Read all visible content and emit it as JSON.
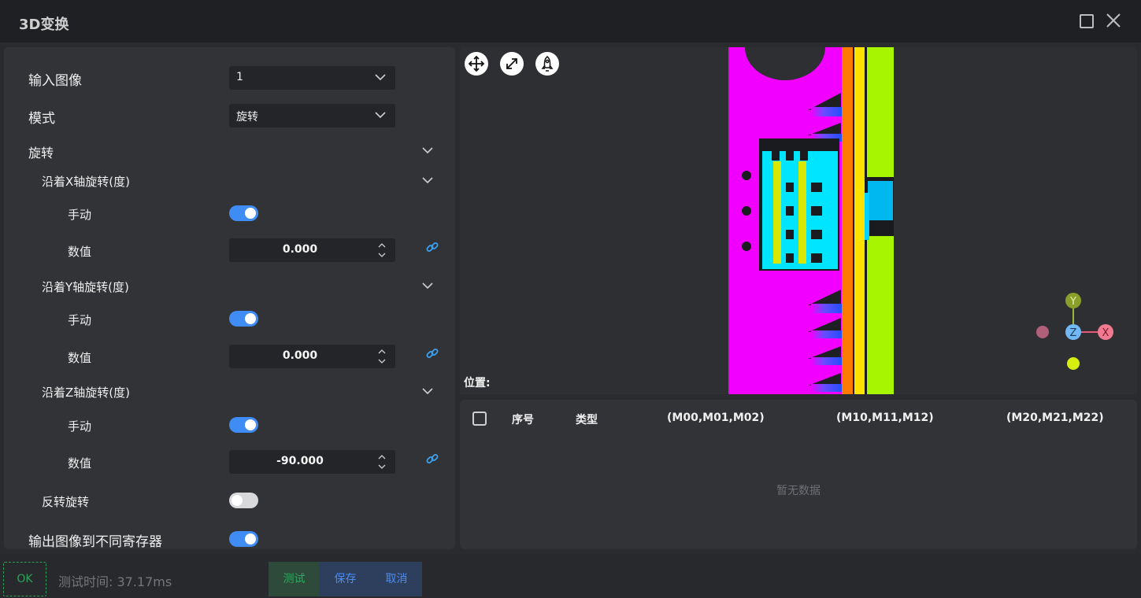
{
  "window": {
    "title": "3D变换"
  },
  "params": {
    "input_image": {
      "label": "输入图像",
      "value": "1"
    },
    "mode": {
      "label": "模式",
      "value": "旋转"
    },
    "rotation_section": "旋转",
    "x_axis": {
      "label": "沿着X轴旋转(度)",
      "manual_label": "手动",
      "manual_on": true,
      "value_label": "数值",
      "value": "0.000"
    },
    "y_axis": {
      "label": "沿着Y轴旋转(度)",
      "manual_label": "手动",
      "manual_on": true,
      "value_label": "数值",
      "value": "0.000"
    },
    "z_axis": {
      "label": "沿着Z轴旋转(度)",
      "manual_label": "手动",
      "manual_on": true,
      "value_label": "数值",
      "value": "-90.000"
    },
    "reverse_rotation": {
      "label": "反转旋转",
      "on": false
    },
    "output_to_registers": {
      "label": "输出图像到不同寄存器",
      "on": true
    }
  },
  "viewport": {
    "position_label": "位置:",
    "tool_icons": [
      "move-icon",
      "fit-view-icon",
      "rocket-icon"
    ],
    "axis_gizmo": {
      "y": "Y",
      "z": "Z",
      "x": "X"
    }
  },
  "table": {
    "headers": [
      "序号",
      "类型",
      "(M00,M01,M02)",
      "(M10,M11,M12)",
      "(M20,M21,M22)"
    ],
    "empty_text": "暂无数据"
  },
  "footer": {
    "status": "OK",
    "test_time": "测试时间: 37.17ms",
    "test_button": "测试",
    "save_button": "保存",
    "cancel_button": "取消"
  },
  "colors": {
    "accent_blue": "#3f8cf5",
    "ok_green": "#2ea35a",
    "magenta_region": "#f200ff",
    "cyan_region": "#00e5ff",
    "lime_region": "#a8f500",
    "orange_region": "#ff7a00",
    "yellow_region": "#ffe100"
  }
}
